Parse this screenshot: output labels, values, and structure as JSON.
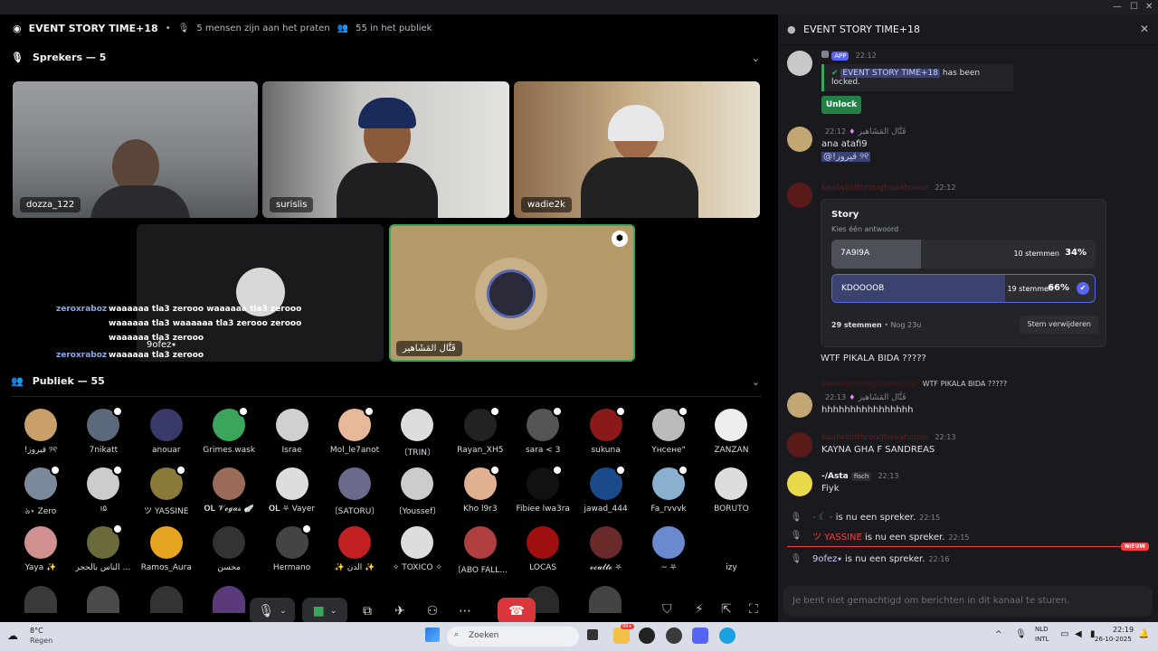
{
  "stage": {
    "title": "EVENT STORY TIME+18",
    "talking": "5 mensen zijn aan het praten",
    "audience_count": "55 in het publiek",
    "speakers_header": "Sprekers — 5",
    "audience_header": "Publiek — 55"
  },
  "speakers": [
    {
      "name": "dozza_122"
    },
    {
      "name": "surislis"
    },
    {
      "name": "wadie2k"
    },
    {
      "name": "9ofez⭑"
    },
    {
      "name": "قَتَّال المَشَاهير"
    }
  ],
  "overlay_chat": [
    {
      "user": "zeroxraboz",
      "text": "waaaaaa tla3 zerooo waaaaaa tla3 zerooo waaaaaa tla3 waaaaaa tla3 zerooo zerooo waaaaaa tla3 zerooo"
    },
    {
      "user": "zeroxraboz",
      "text": "waaaaaa tla3 zerooo"
    }
  ],
  "audience": [
    {
      "name": "!قيروز ୨୧",
      "color": "#c9a06a"
    },
    {
      "name": "7nikatt",
      "color": "#5a6a7a"
    },
    {
      "name": "anouar",
      "color": "#3a3a6a"
    },
    {
      "name": "Grimes.wask",
      "color": "#3ba55c"
    },
    {
      "name": "Israe",
      "color": "#d0d0d0"
    },
    {
      "name": "Mol_le7anot",
      "color": "#e8b89a"
    },
    {
      "name": "〔TRIN〕",
      "color": "#ddd"
    },
    {
      "name": "Rayan_XH5",
      "color": "#222"
    },
    {
      "name": "sara < 3",
      "color": "#555"
    },
    {
      "name": "sukuna",
      "color": "#8a1a1a"
    },
    {
      "name": "Үнсене\"",
      "color": "#bbb"
    },
    {
      "name": "ZANZAN",
      "color": "#eee"
    },
    {
      "name": "ঌ⋆ Zero",
      "color": "#7a8a9a"
    },
    {
      "name": "ı۵",
      "color": "#ccc"
    },
    {
      "name": "ツ YASSINE",
      "color": "#8a7a3a"
    },
    {
      "name": "𝐎𝐋 𝓥𝓮𝓰𝓪𝓼 🪽",
      "color": "#9a6a5a"
    },
    {
      "name": "𝐎𝐋 ⛧ Vayer",
      "color": "#ddd"
    },
    {
      "name": "〔SATORU〕",
      "color": "#6a6a8a"
    },
    {
      "name": "〔Youssef〕",
      "color": "#ccc"
    },
    {
      "name": "Kho l9r3",
      "color": "#e0b090"
    },
    {
      "name": "Fibiee lwa3ra",
      "color": "#111"
    },
    {
      "name": "jawad_444",
      "color": "#1a4a8a"
    },
    {
      "name": "Fa_rvvvk",
      "color": "#8ab0d0"
    },
    {
      "name": "BORUTO",
      "color": "#ddd"
    },
    {
      "name": "Yaya ✨",
      "color": "#d09090"
    },
    {
      "name": "دیور الناس بالحجر",
      "color": "#6a6a3a"
    },
    {
      "name": "Ramos_Aura",
      "color": "#e5a520"
    },
    {
      "name": "محسن",
      "color": "#333"
    },
    {
      "name": "Hermano",
      "color": "#444"
    },
    {
      "name": "✨ الدن ✨",
      "color": "#c02020"
    },
    {
      "name": "✧ TOXICO ✧",
      "color": "#ddd"
    },
    {
      "name": "〔ABO FALL...",
      "color": "#b04040"
    },
    {
      "name": "LOCAS",
      "color": "#a01010"
    },
    {
      "name": "𝓸𝓬𝓾𝓵𝓽𝓸 ⛧",
      "color": "#6a2a2a"
    },
    {
      "name": "~ ⛧",
      "color": "#6a8ad0"
    },
    {
      "name": "izy",
      "color": "#000"
    }
  ],
  "chat": {
    "title": "EVENT STORY TIME+18",
    "app_badge": "APP",
    "t1": "22:12",
    "locked_channel": "EVENT STORY TIME+18",
    "locked_suffix": "has been locked.",
    "unlock": "Unlock",
    "m2_user": "قَتَّال المَشَاهير",
    "m2_time": "22:12",
    "m2_text": "ana atafi9",
    "m2_mention": "@!قيروز ୨୧",
    "m3_user": "kaalwiiidthroughaaahouse",
    "m3_time": "22:12",
    "poll": {
      "question": "Story",
      "hint": "Kies één antwoord",
      "options": [
        {
          "label": "7A9I9A",
          "count": "10 stemmen",
          "pct": "34%",
          "value": 0.34,
          "selected": false
        },
        {
          "label": "KDOOOOB",
          "count": "19 stemmen",
          "pct": "66%",
          "value": 0.66,
          "selected": true
        }
      ],
      "total": "29 stemmen",
      "remaining": "Nog 23u",
      "remove": "Stem verwijderen"
    },
    "m3_text": "WTF PIKALA BIDA ?????",
    "reply_user": "kaalwiiidthroughaaahouse",
    "reply_text": "WTF PIKALA BIDA ?????",
    "m4_user": "قَتَّال المَشَاهير",
    "m4_time": "22:13",
    "m4_text": "hhhhhhhhhhhhhhhh",
    "m5_user": "kaalwiiidthroughaaahouse",
    "m5_time": "22:13",
    "m5_text": "KAYNA GHA F SANDREAS",
    "m6_user": "-/Asta",
    "m6_tag": "fisch",
    "m6_time": "22:13",
    "m6_text": "Fiyk",
    "s1_user": "- ☾ -",
    "s1_text": "is nu een spreker.",
    "s1_time": "22:15",
    "s2_user": "ツ YASSINE",
    "s2_text": "is nu een spreker.",
    "s2_time": "22:15",
    "new_badge": "NIEUW",
    "s3_user": "9ofez⭑",
    "s3_text": "is nu een spreker.",
    "s3_time": "22:16",
    "input_placeholder": "Je bent niet gemachtigd om berichten in dit kanaal te sturen."
  },
  "taskbar": {
    "temp": "8°C",
    "weather": "Regen",
    "search": "Zoeken",
    "lang1": "NLD",
    "lang2": "INTL",
    "time": "22:19",
    "date": "26-10-2025",
    "badge": "99+"
  }
}
